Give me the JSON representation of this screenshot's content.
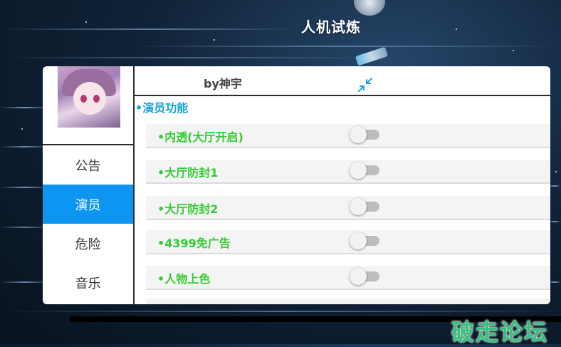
{
  "game": {
    "title": "人机试炼"
  },
  "menu": {
    "author": "by神宇",
    "nav": [
      "公告",
      "演员",
      "危险",
      "音乐"
    ],
    "active_index": 1,
    "section": "•演员功能",
    "features": [
      {
        "label": "•内透(大厅开启)",
        "enabled": false
      },
      {
        "label": "•大厅防封1",
        "enabled": false
      },
      {
        "label": "•大厅防封2",
        "enabled": false
      },
      {
        "label": "•4399免广告",
        "enabled": false
      },
      {
        "label": "•人物上色",
        "enabled": false
      }
    ],
    "accent_color": "#0d95f2",
    "label_color": "#33cc33"
  },
  "watermark": "破走论坛"
}
